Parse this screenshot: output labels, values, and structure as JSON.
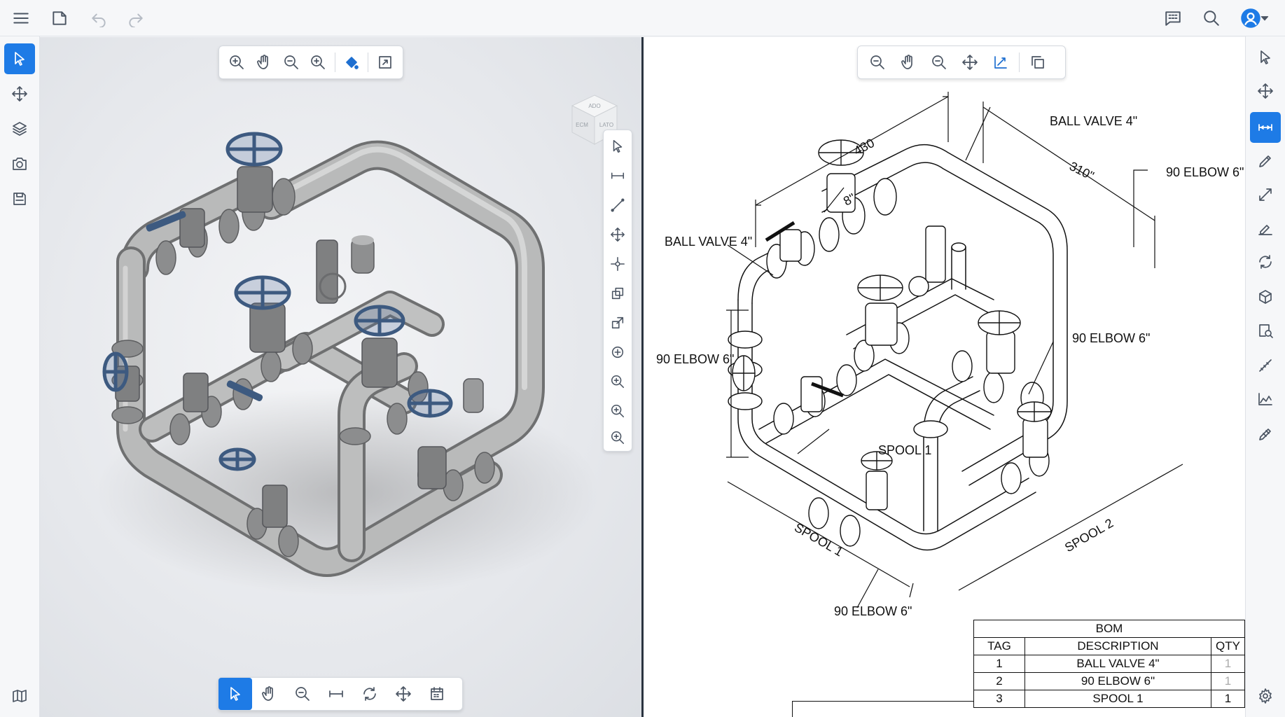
{
  "topbar": {
    "icons": [
      "menu-icon",
      "new-file-icon",
      "undo-icon",
      "redo-icon",
      "comments-icon",
      "search-icon",
      "user-avatar-icon",
      "chevron-down-icon"
    ]
  },
  "left_toolbar": {
    "tools": [
      "select",
      "move",
      "layers",
      "snapshot",
      "save",
      "library"
    ],
    "active": "select"
  },
  "viewport3d": {
    "top_toolbar": [
      "zoom-in",
      "pan",
      "zoom-out",
      "zoom-window",
      "paint-bucket",
      "fit-to-screen"
    ],
    "side_toolbar": [
      "select",
      "measure-distance",
      "line",
      "move",
      "point",
      "copy",
      "link",
      "add-point",
      "zoom-in",
      "zoom-in",
      "zoom-in"
    ],
    "bottom_toolbar": [
      "select",
      "pan",
      "zoom-out",
      "measure",
      "rotate",
      "move",
      "calendar"
    ],
    "bottom_active": "select",
    "viewcube_faces": [
      "ADO",
      "ECM",
      "LATO"
    ]
  },
  "drawing": {
    "top_toolbar": [
      "zoom-out",
      "pan",
      "zoom-out",
      "move",
      "sketch",
      "copy"
    ],
    "labels": {
      "ball_valve_top": "BALL VALVE 4\"",
      "elbow_top_right": "90 ELBOW 6\"",
      "ball_valve_left": "BALL VALVE 4\"",
      "elbow_mid_right": "90 ELBOW 6\"",
      "elbow_left": "90 ELBOW 6\"",
      "spool_1_callout": "SPOOL 1",
      "elbow_bottom": "90 ELBOW 6\""
    },
    "dimensions": {
      "dim_430": "430",
      "dim_8": "8\"",
      "dim_310": "310\"",
      "spool_1_dim": "SPOOL 1",
      "spool_2_dim": "SPOOL 2"
    },
    "bom": {
      "title": "BOM",
      "headers": [
        "TAG",
        "DESCRIPTION",
        "QTY"
      ],
      "rows": [
        [
          "1",
          "BALL VALVE 4\"",
          "1"
        ],
        [
          "2",
          "90 ELBOW 6\"",
          "1"
        ],
        [
          "3",
          "SPOOL 1",
          "1"
        ]
      ]
    }
  },
  "right_toolbar": {
    "tools": [
      "select",
      "move",
      "dimension",
      "pencil",
      "diagonal-dimension",
      "highlighter",
      "rotate",
      "cube",
      "inspect",
      "measure-line",
      "graph",
      "edit-pen",
      "settings"
    ],
    "active": "dimension"
  },
  "colors": {
    "accent": "#1e7be6",
    "handwheel": "#3d5a80",
    "pipe": "#a9aaab",
    "toolbar_bg": "#f6f7f9"
  }
}
